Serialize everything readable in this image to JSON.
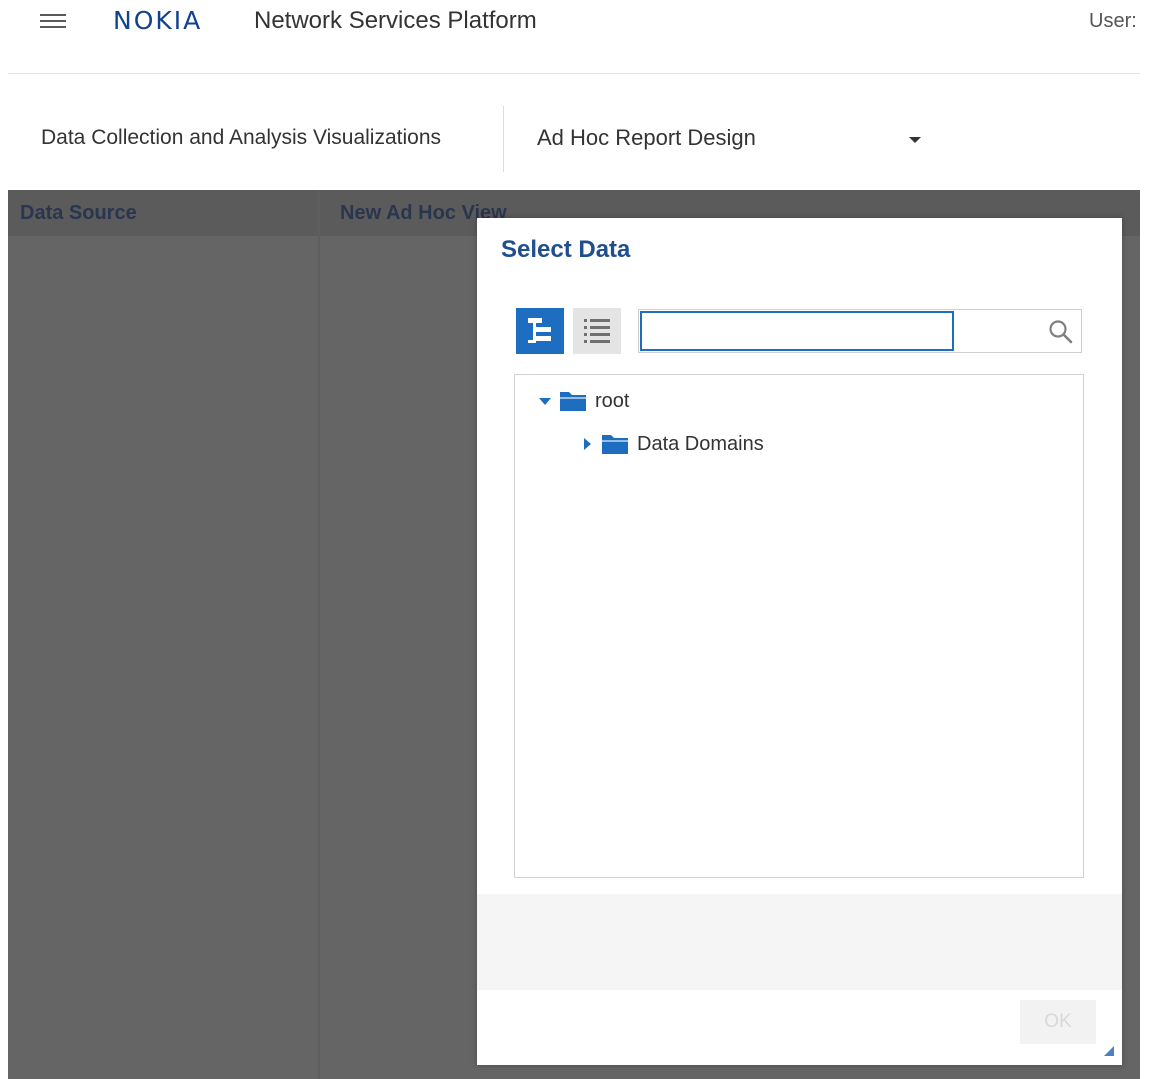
{
  "header": {
    "logo_text": "NOKIA",
    "app_title": "Network Services Platform",
    "user_label": "User:"
  },
  "subnav": {
    "title": "Data Collection and Analysis Visualizations",
    "report_select": {
      "selected": "Ad Hoc Report Design"
    }
  },
  "workspace": {
    "left_column_label": "Data Source",
    "right_column_label": "New Ad Hoc View"
  },
  "dialog": {
    "title": "Select Data",
    "view_buttons": {
      "tree_icon": "tree-view-icon",
      "list_icon": "list-view-icon"
    },
    "search": {
      "value": "",
      "placeholder": ""
    },
    "tree": {
      "root": {
        "label": "root",
        "expanded": true
      },
      "children": [
        {
          "label": "Data Domains",
          "expanded": false
        }
      ]
    },
    "ok_label": "OK",
    "ok_enabled": false
  },
  "colors": {
    "brand": "#124191",
    "accent": "#1d6ec0",
    "overlay": "#656565",
    "dialog_title": "#1f4f8f"
  }
}
